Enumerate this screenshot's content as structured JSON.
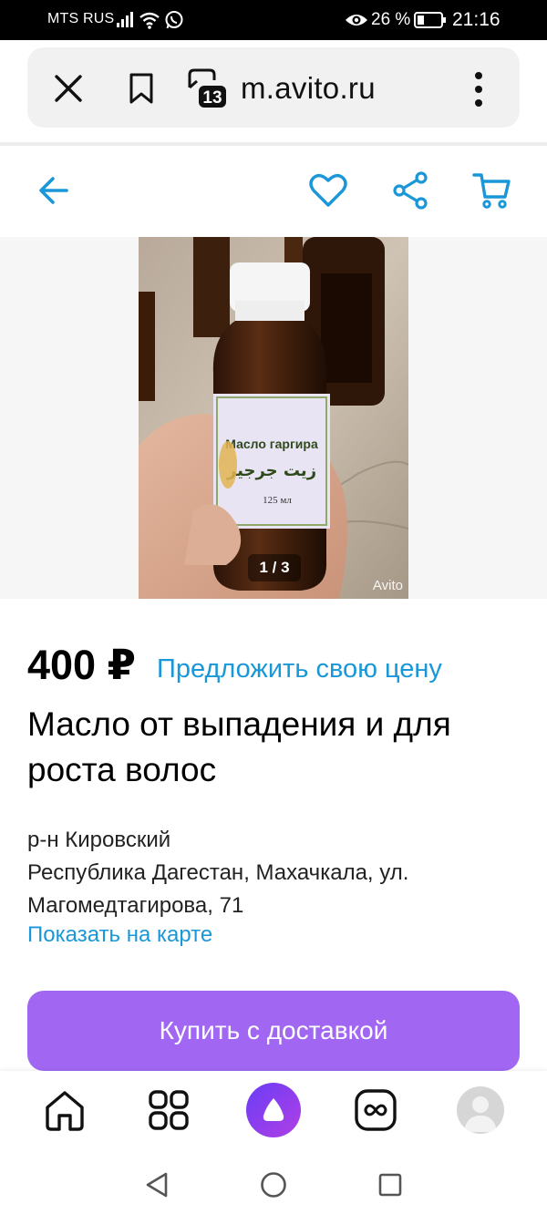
{
  "status_bar": {
    "carrier": "MTS RUS",
    "battery_percent": "26 %",
    "time": "21:16",
    "icons": [
      "signal-icon",
      "wifi-icon",
      "whatsapp-icon",
      "eye-icon",
      "battery-icon"
    ]
  },
  "browser": {
    "url": "m.avito.ru",
    "tab_count": "13",
    "icons": [
      "close-icon",
      "bookmark-icon",
      "tabs-icon",
      "more-vert-icon"
    ]
  },
  "header": {
    "icons": [
      "back-arrow-icon",
      "heart-icon",
      "share-icon",
      "cart-icon"
    ],
    "accent_color": "#1a97d8"
  },
  "gallery": {
    "counter": "1 / 3",
    "label_line1": "Масло гаргира",
    "label_line2": "زيت جرجير",
    "label_volume": "125 мл",
    "watermark": "Avito"
  },
  "listing": {
    "price": "400 ₽",
    "offer_link": "Предложить свою цену",
    "title": "Масло от выпадения и для роста волос",
    "district": "р-н Кировский",
    "address": "Республика Дагестан, Махачкала, ул. Магомедтагирова, 71",
    "map_link": "Показать на карте",
    "buy_button": "Купить с доставкой",
    "buy_button_color": "#a167f3"
  },
  "bottom_toolbar": {
    "icons": [
      "home-icon",
      "apps-grid-icon",
      "alice-icon",
      "tabs-infinity-icon",
      "avatar"
    ]
  },
  "system_nav": {
    "icons": [
      "nav-back-icon",
      "nav-home-icon",
      "nav-recents-icon"
    ]
  }
}
